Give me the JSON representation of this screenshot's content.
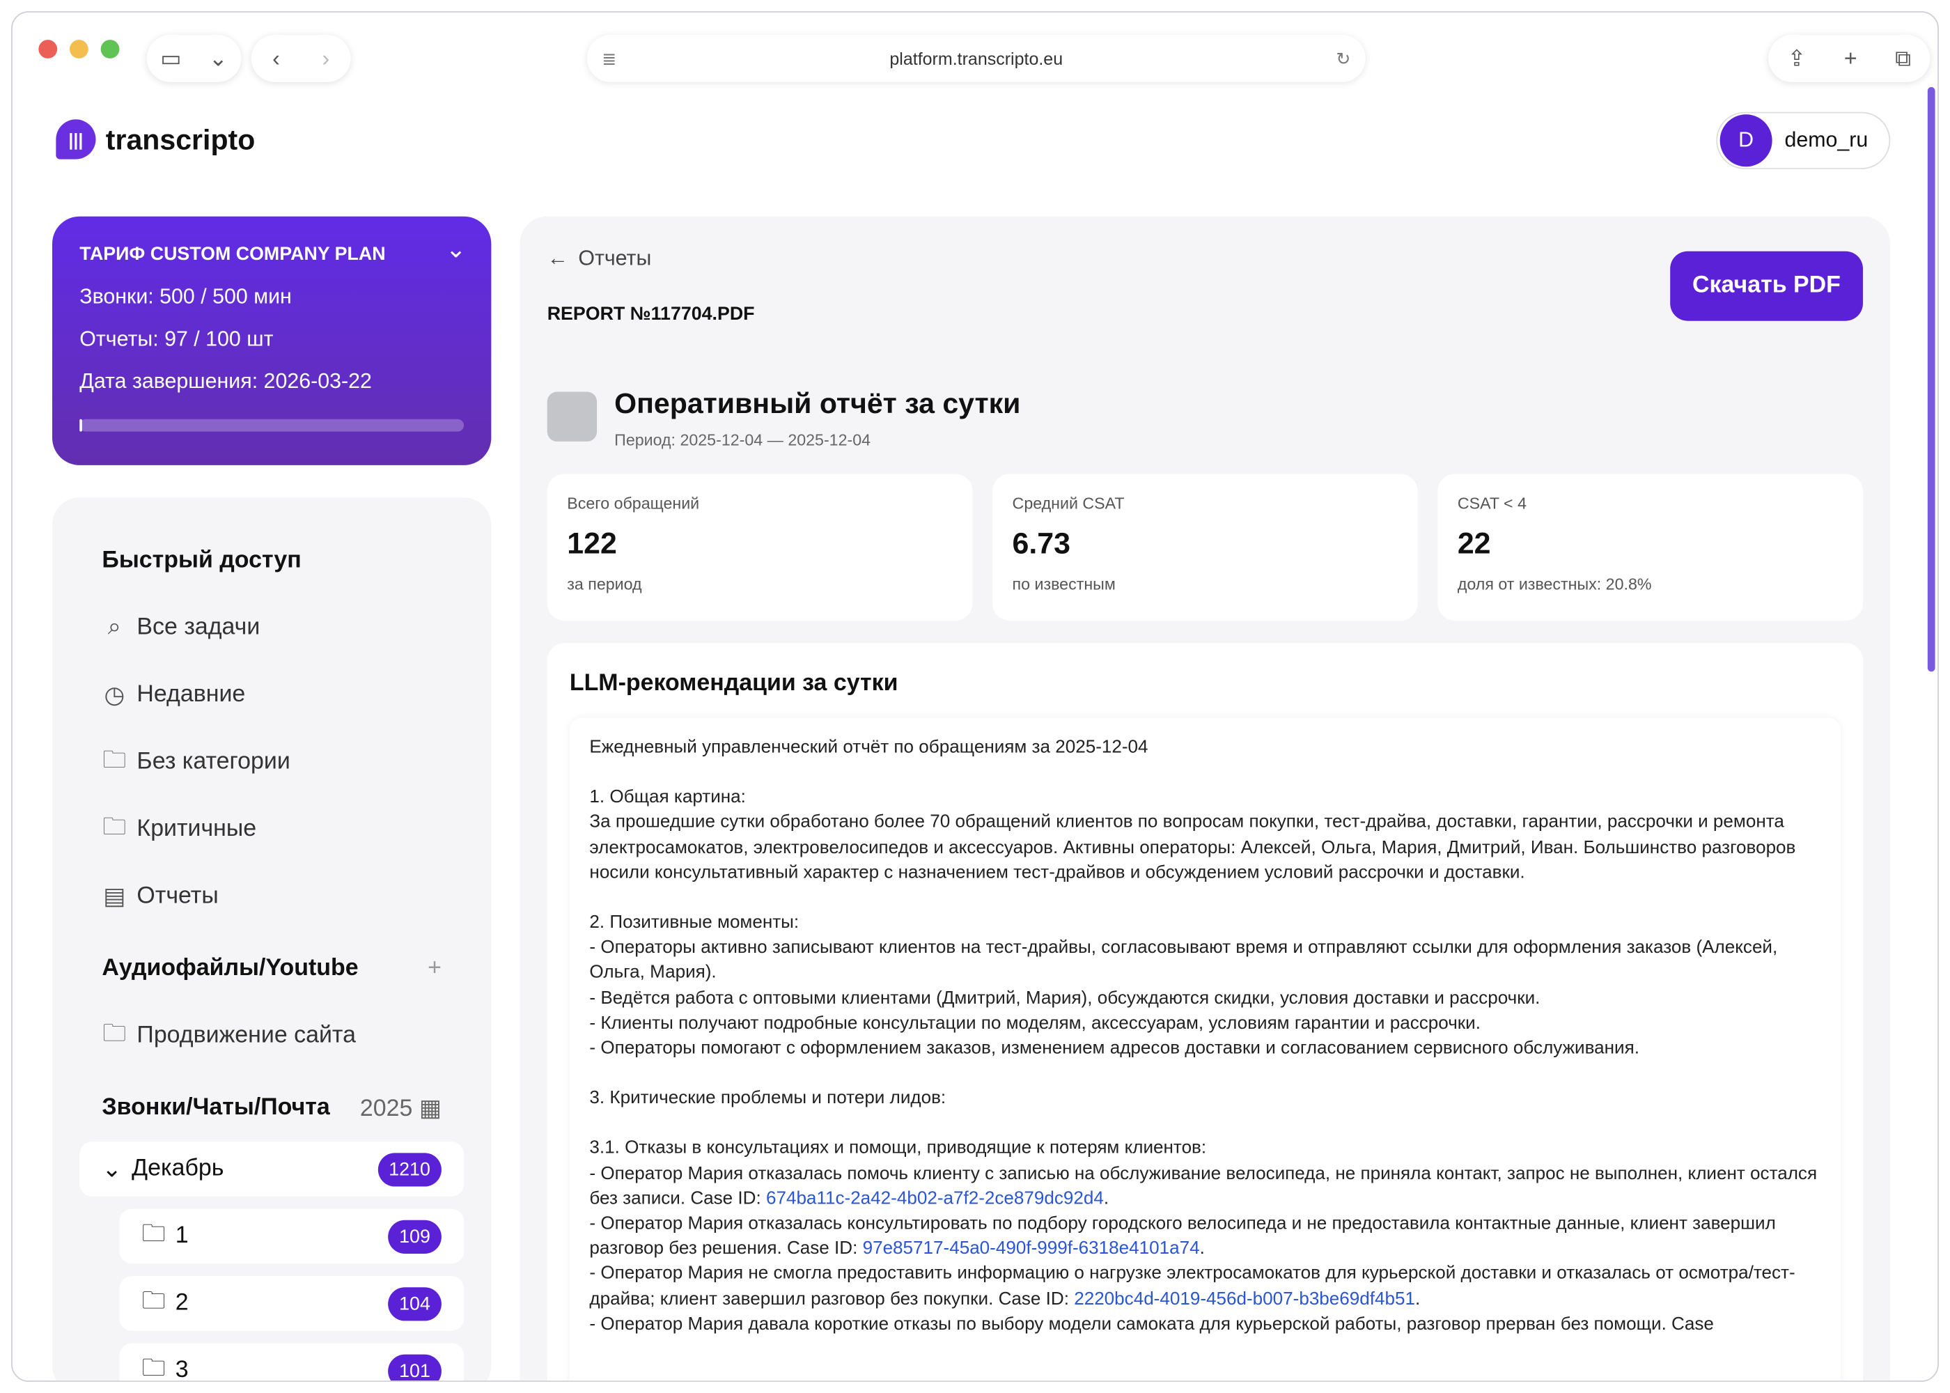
{
  "browser": {
    "url": "platform.transcripto.eu"
  },
  "app": {
    "logo": "transcripto",
    "user_initial": "D",
    "username": "demo_ru"
  },
  "plan": {
    "title": "ТАРИФ CUSTOM COMPANY PLAN",
    "calls": "Звонки: 500 / 500 мин",
    "reports": "Отчеты: 97 / 100 шт",
    "end_date": "Дата завершения: 2026-03-22",
    "progress_percent": 0
  },
  "sidebar": {
    "quick_title": "Быстрый доступ",
    "quick": [
      "Все задачи",
      "Недавние",
      "Без категории",
      "Критичные",
      "Отчеты"
    ],
    "audio_title": "Аудиофайлы/Youtube",
    "audio_items": [
      "Продвижение сайта"
    ],
    "calls_title": "Звонки/Чаты/Почта",
    "year": "2025",
    "month": {
      "label": "Декабрь",
      "count": "1210"
    },
    "days": [
      {
        "label": "1",
        "count": "109"
      },
      {
        "label": "2",
        "count": "104"
      },
      {
        "label": "3",
        "count": "101"
      }
    ]
  },
  "main": {
    "back": "Отчеты",
    "file": "REPORT №117704.PDF",
    "download": "Скачать PDF",
    "title": "Оперативный отчёт за сутки",
    "period": "Период: 2025-12-04 — 2025-12-04",
    "stats": [
      {
        "label": "Всего обращений",
        "value": "122",
        "note": "за период"
      },
      {
        "label": "Средний CSAT",
        "value": "6.73",
        "note": "по известным"
      },
      {
        "label": "CSAT < 4",
        "value": "22",
        "note": "доля от известных: 20.8%"
      }
    ],
    "llm_title": "LLM-рекомендации за сутки",
    "text": {
      "intro": "Ежедневный управленческий отчёт по обращениям за 2025-12-04",
      "s1": "1. Общая картина:",
      "s1t": "За прошедшие сутки обработано более 70 обращений клиентов по вопросам покупки, тест-драйва, доставки, гарантии, рассрочки и ремонта электросамокатов, электровелосипедов и аксессуаров. Активны операторы: Алексей, Ольга, Мария, Дмитрий, Иван. Большинство разговоров носили консультативный характер с назначением тест-драйвов и обсуждением условий рассрочки и доставки.",
      "s2": "2. Позитивные моменты:",
      "s2a": "- Операторы активно записывают клиентов на тест-драйвы, согласовывают время и отправляют ссылки для оформления заказов (Алексей, Ольга, Мария).",
      "s2b": "- Ведётся работа с оптовыми клиентами (Дмитрий, Мария), обсуждаются скидки, условия доставки и рассрочки.",
      "s2c": "- Клиенты получают подробные консультации по моделям, аксессуарам, условиям гарантии и рассрочки.",
      "s2d": "- Операторы помогают с оформлением заказов, изменением адресов доставки и согласованием сервисного обслуживания.",
      "s3": "3. Критические проблемы и потери лидов:",
      "s31": "3.1. Отказы в консультациях и помощи, приводящие к потерям клиентов:",
      "c1": "- Оператор Мария отказалась помочь клиенту с записью на обслуживание велосипеда, не приняла контакт, запрос не выполнен, клиент остался без записи. Case ID: ",
      "id1": "674ba11c-2a42-4b02-a7f2-2ce879dc92d4",
      "c2": "- Оператор Мария отказалась консультировать по подбору городского велосипеда и не предоставила контактные данные, клиент завершил разговор без решения. Case ID: ",
      "id2": "97e85717-45a0-490f-999f-6318e4101a74",
      "c3": "- Оператор Мария не смогла предоставить информацию о нагрузке электросамокатов для курьерской доставки и отказалась от осмотра/тест-драйва; клиент завершил разговор без покупки. Case ID: ",
      "id3": "2220bc4d-4019-456d-b007-b3be69df4b51",
      "c4": "- Оператор Мария давала короткие отказы по выбору модели самоката для курьерской работы, разговор прерван без помощи. Case",
      "dot": "."
    }
  }
}
